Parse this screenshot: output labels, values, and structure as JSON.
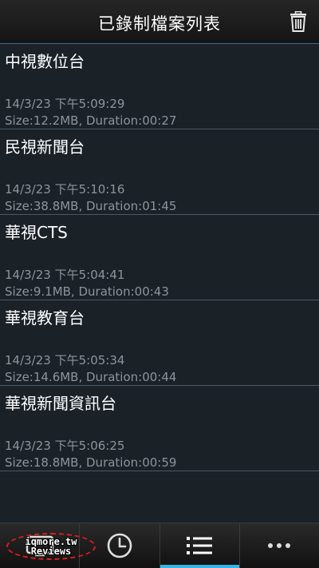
{
  "header": {
    "title": "已錄制檔案列表",
    "trash_icon": "trash-icon"
  },
  "recordings": [
    {
      "name": "中視數位台",
      "date": "14/3/23 下午5:09:29",
      "info": "Size:12.2MB,  Duration:00:27"
    },
    {
      "name": "民視新聞台",
      "date": "14/3/23 下午5:10:16",
      "info": "Size:38.8MB,  Duration:01:45"
    },
    {
      "name": "華視CTS",
      "date": "14/3/23 下午5:04:41",
      "info": "Size:9.1MB,  Duration:00:43"
    },
    {
      "name": "華視教育台",
      "date": "14/3/23 下午5:05:34",
      "info": "Size:14.6MB,  Duration:00:44"
    },
    {
      "name": "華視新聞資訊台",
      "date": "14/3/23 下午5:06:25",
      "info": "Size:18.8MB,  Duration:00:59"
    }
  ],
  "bottom_tabs": [
    {
      "icon": "tv-icon",
      "active": false
    },
    {
      "icon": "clock-icon",
      "active": false
    },
    {
      "icon": "list-icon",
      "active": true
    },
    {
      "icon": "more-icon",
      "active": false
    }
  ],
  "watermark": {
    "line1": "iqmore.tw",
    "line2": "Reviews"
  },
  "colors": {
    "accent": "#33b5e5",
    "background": "#1a2127",
    "secondary_text": "#8c959c",
    "watermark_border": "#e21a1a"
  }
}
